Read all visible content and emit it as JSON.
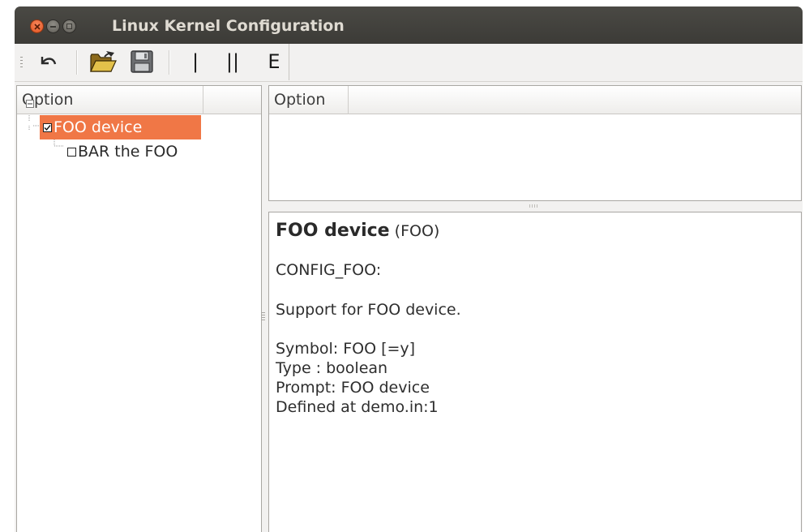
{
  "window": {
    "title": "Linux Kernel Configuration"
  },
  "toolbar": {
    "items": [
      {
        "name": "back",
        "icon": "undo-icon"
      },
      {
        "name": "open",
        "icon": "folder-open-icon"
      },
      {
        "name": "save",
        "icon": "save-icon"
      },
      {
        "name": "single-view",
        "label": "|"
      },
      {
        "name": "split-view",
        "label": "||"
      },
      {
        "name": "full-view",
        "label": "E"
      }
    ]
  },
  "left_pane": {
    "header": "Option",
    "tree": [
      {
        "label": "FOO device",
        "checked": true,
        "selected": true,
        "expanded": true
      },
      {
        "label": "BAR the FOO",
        "checked": false,
        "selected": false
      }
    ]
  },
  "right_top": {
    "header": "Option"
  },
  "info": {
    "title": "FOO device",
    "symbol_paren": "(FOO)",
    "config": "CONFIG_FOO:",
    "help": "Support for FOO device.",
    "symbol_line": "Symbol: FOO [=y]",
    "type_line": "Type : boolean",
    "prompt_line": "Prompt: FOO device",
    "defined_line": "Defined at demo.in:1"
  },
  "colors": {
    "selection": "#f07746",
    "titlebar": "#3c3b37",
    "close_button": "#e3541f"
  }
}
